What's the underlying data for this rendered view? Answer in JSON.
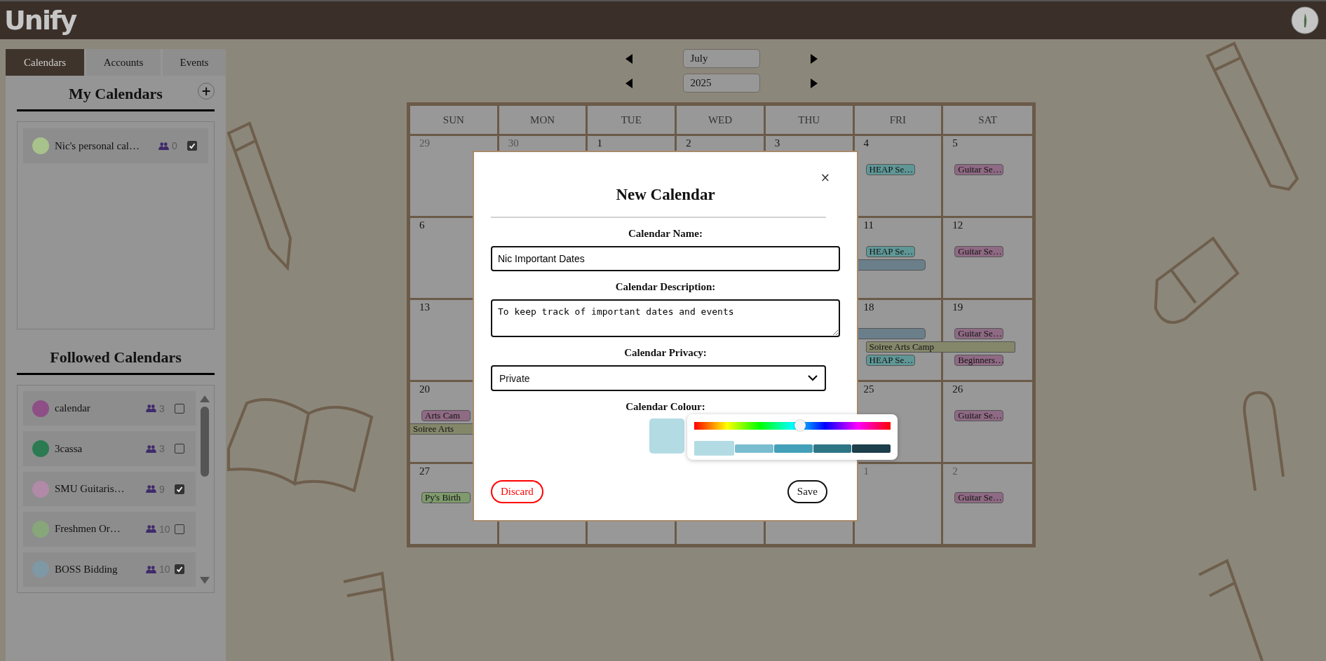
{
  "header": {
    "logo": "Unify"
  },
  "sidebar": {
    "tabs": [
      {
        "label": "Calendars",
        "selected": true
      },
      {
        "label": "Accounts",
        "selected": false
      },
      {
        "label": "Events",
        "selected": false
      }
    ],
    "my_calendars": {
      "title": "My Calendars",
      "add_label": "+",
      "items": [
        {
          "name": "Nic's personal cal…",
          "color": "#a7c28a",
          "followers": "0",
          "checked": true
        }
      ]
    },
    "followed_calendars": {
      "title": "Followed Calendars",
      "items": [
        {
          "name": "calendar",
          "color": "#8d4f86",
          "followers": "3",
          "checked": false
        },
        {
          "name": "3cassa",
          "color": "#2b7a52",
          "followers": "3",
          "checked": false
        },
        {
          "name": "SMU Guitaris…",
          "color": "#b08aa6",
          "followers": "9",
          "checked": true
        },
        {
          "name": "Freshmen Or…",
          "color": "#87a77a",
          "followers": "10",
          "checked": false
        },
        {
          "name": "BOSS Bidding",
          "color": "#7e98a6",
          "followers": "10",
          "checked": true
        }
      ]
    }
  },
  "calendar": {
    "month": "July",
    "year": "2025",
    "weekdays": [
      "SUN",
      "MON",
      "TUE",
      "WED",
      "THU",
      "FRI",
      "SAT"
    ],
    "weeks": [
      {
        "sun": {
          "date": "29",
          "muted": true
        },
        "mon": {
          "date": "30",
          "muted": true
        },
        "tue": {
          "date": "1",
          "muted": false
        },
        "wed": {
          "date": "2",
          "muted": false
        },
        "thu": {
          "date": "3",
          "muted": false
        },
        "fri": {
          "date": "4",
          "muted": false,
          "events": [
            {
              "label": "HEAP Se…",
              "color": "#5f9796",
              "kind": "single"
            }
          ]
        },
        "sat": {
          "date": "5",
          "muted": false,
          "events": [
            {
              "label": "Guitar Se…",
              "color": "#8f6a84",
              "kind": "single"
            }
          ]
        }
      },
      {
        "sun": {
          "date": "6",
          "muted": false
        },
        "fri": {
          "date": "11",
          "muted": false,
          "events": [
            {
              "label": "HEAP Se…",
              "color": "#5f9796",
              "kind": "single"
            },
            {
              "color": "#6a7f8a",
              "kind": "continued"
            }
          ]
        },
        "sat": {
          "date": "12",
          "muted": false,
          "events": [
            {
              "label": "Guitar Se…",
              "color": "#8f6a84",
              "kind": "single"
            }
          ]
        }
      },
      {
        "sun": {
          "date": "13",
          "muted": false
        },
        "fri": {
          "date": "18",
          "muted": false,
          "events": [
            {
              "color": "#6a7f8a",
              "kind": "continued"
            },
            {
              "label": "Soiree Arts Camp",
              "color": "#85876a",
              "kind": "multi"
            },
            {
              "label": "HEAP Se…",
              "color": "#5f9796",
              "kind": "single"
            }
          ]
        },
        "sat": {
          "date": "19",
          "muted": false,
          "events": [
            {
              "label": "Guitar Se…",
              "color": "#8f6a84",
              "kind": "single"
            },
            {
              "label": "Beginners…",
              "color": "#8f6a84",
              "kind": "single"
            }
          ]
        }
      },
      {
        "sun": {
          "date": "20",
          "muted": false,
          "events": [
            {
              "label": "Arts Cam",
              "color": "#8f6a84",
              "kind": "single"
            },
            {
              "label": "Soiree Arts",
              "color": "#85876a",
              "kind": "continued"
            }
          ]
        },
        "fri": {
          "date": "25",
          "muted": false
        },
        "sat": {
          "date": "26",
          "muted": false,
          "events": [
            {
              "label": "Guitar Se…",
              "color": "#8f6a84",
              "kind": "single"
            }
          ]
        }
      },
      {
        "sun": {
          "date": "27",
          "muted": false,
          "events": [
            {
              "label": "Py's Birth",
              "color": "#7f9a6c",
              "kind": "single"
            }
          ]
        },
        "fri": {
          "date": "1",
          "muted": true
        },
        "sat": {
          "date": "2",
          "muted": true,
          "events": [
            {
              "label": "Guitar Se…",
              "color": "#8f6a84",
              "kind": "single"
            }
          ]
        }
      }
    ]
  },
  "dialog": {
    "title": "New Calendar",
    "close": "×",
    "fields": [
      {
        "label": "Calendar Name:",
        "kind": "text",
        "value": "Nic Important Dates"
      },
      {
        "label": "Calendar Description:",
        "kind": "textarea",
        "value": "To keep track of important dates and events"
      },
      {
        "label": "Calendar Privacy:",
        "kind": "select",
        "value": "Private"
      }
    ],
    "colour": {
      "label": "Calendar Colour:",
      "color": "#b3dbe4",
      "hue": {
        "level": 0.54
      },
      "shades": [
        {
          "color": "#b3dbe4",
          "selected": true
        },
        {
          "color": "#7abdd0",
          "selected": false
        },
        {
          "color": "#43a0b8",
          "selected": false
        },
        {
          "color": "#2e7585",
          "selected": false
        },
        {
          "color": "#1d3e4b",
          "selected": false
        }
      ]
    },
    "buttons": [
      {
        "label": "Discard",
        "kind": "danger"
      },
      {
        "label": "Save",
        "kind": "primary"
      }
    ]
  }
}
